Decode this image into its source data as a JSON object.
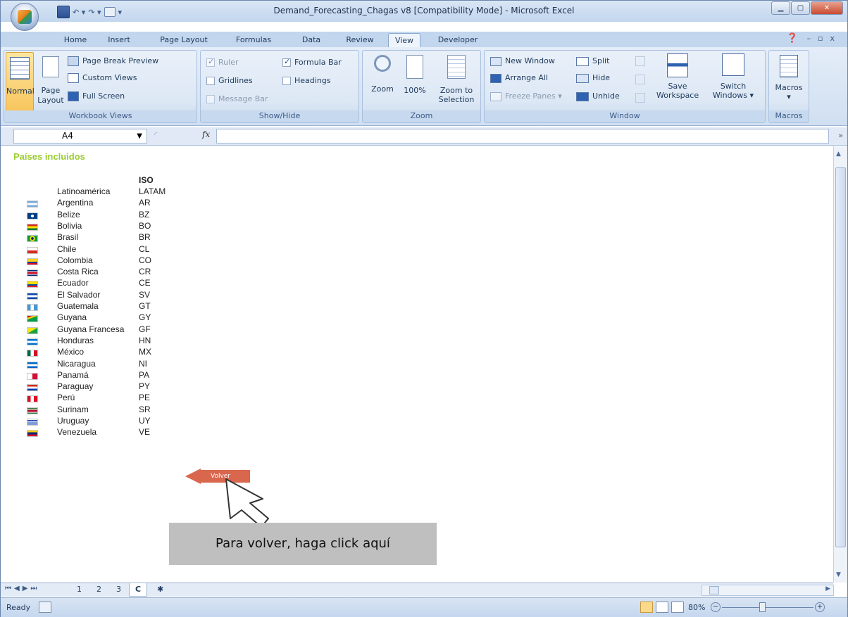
{
  "window": {
    "title": "Demand_Forecasting_Chagas v8  [Compatibility Mode] - Microsoft Excel"
  },
  "tabs": [
    "Home",
    "Insert",
    "Page Layout",
    "Formulas",
    "Data",
    "Review",
    "View",
    "Developer"
  ],
  "active_tab": "View",
  "ribbon": {
    "workbook_views": {
      "label": "Workbook Views",
      "normal": "Normal",
      "page_layout_1": "Page",
      "page_layout_2": "Layout",
      "page_break": "Page Break Preview",
      "custom_views": "Custom Views",
      "full_screen": "Full Screen"
    },
    "show_hide": {
      "label": "Show/Hide",
      "ruler": "Ruler",
      "gridlines": "Gridlines",
      "message_bar": "Message Bar",
      "formula_bar": "Formula Bar",
      "headings": "Headings"
    },
    "zoom": {
      "label": "Zoom",
      "zoom": "Zoom",
      "hundred": "100%",
      "zoom_sel_1": "Zoom to",
      "zoom_sel_2": "Selection"
    },
    "window": {
      "label": "Window",
      "new_window": "New Window",
      "arrange_all": "Arrange All",
      "freeze_panes": "Freeze Panes",
      "split": "Split",
      "hide": "Hide",
      "unhide": "Unhide",
      "save_ws_1": "Save",
      "save_ws_2": "Workspace",
      "switch_1": "Switch",
      "switch_2": "Windows"
    },
    "macros": {
      "label": "Macros",
      "macros": "Macros"
    }
  },
  "formula_bar": {
    "name_box": "A4",
    "fx": "fx",
    "content": ""
  },
  "sheet": {
    "heading": "Países incluidos",
    "iso_header": "ISO",
    "countries": [
      {
        "name": "Latinoamérica",
        "iso": "LATAM",
        "flag": ""
      },
      {
        "name": "Argentina",
        "iso": "AR",
        "flag": "argentina-flag-icon"
      },
      {
        "name": "Belize",
        "iso": "BZ",
        "flag": "belize-flag-icon"
      },
      {
        "name": "Bolivia",
        "iso": "BO",
        "flag": "bolivia-flag-icon"
      },
      {
        "name": "Brasil",
        "iso": "BR",
        "flag": "brasil-flag-icon"
      },
      {
        "name": "Chile",
        "iso": "CL",
        "flag": "chile-flag-icon"
      },
      {
        "name": "Colombia",
        "iso": "CO",
        "flag": "colombia-flag-icon"
      },
      {
        "name": "Costa Rica",
        "iso": "CR",
        "flag": "costa-rica-flag-icon"
      },
      {
        "name": "Ecuador",
        "iso": "CE",
        "flag": "ecuador-flag-icon"
      },
      {
        "name": "El Salvador",
        "iso": "SV",
        "flag": "el-salvador-flag-icon"
      },
      {
        "name": "Guatemala",
        "iso": "GT",
        "flag": "guatemala-flag-icon"
      },
      {
        "name": "Guyana",
        "iso": "GY",
        "flag": "guyana-flag-icon"
      },
      {
        "name": "Guyana Francesa",
        "iso": "GF",
        "flag": "guyana-francesa-flag-icon"
      },
      {
        "name": "Honduras",
        "iso": "HN",
        "flag": "honduras-flag-icon"
      },
      {
        "name": "México",
        "iso": "MX",
        "flag": "mexico-flag-icon"
      },
      {
        "name": "Nicaragua",
        "iso": "NI",
        "flag": "nicaragua-flag-icon"
      },
      {
        "name": "Panamá",
        "iso": "PA",
        "flag": "panama-flag-icon"
      },
      {
        "name": "Paraguay",
        "iso": "PY",
        "flag": "paraguay-flag-icon"
      },
      {
        "name": "Perú",
        "iso": "PE",
        "flag": "peru-flag-icon"
      },
      {
        "name": "Surinam",
        "iso": "SR",
        "flag": "surinam-flag-icon"
      },
      {
        "name": "Uruguay",
        "iso": "UY",
        "flag": "uruguay-flag-icon"
      },
      {
        "name": "Venezuela",
        "iso": "VE",
        "flag": "venezuela-flag-icon"
      }
    ],
    "volver_label": "Volver",
    "callout": "Para volver, haga click aquí"
  },
  "sheet_tabs": [
    "1",
    "2",
    "3",
    "C"
  ],
  "active_sheet": "C",
  "status": {
    "ready": "Ready",
    "zoom": "80%"
  },
  "colors": {
    "heading": "#9ACD32",
    "volver": "#D9674E",
    "callout_bg": "#BFBFBF"
  }
}
